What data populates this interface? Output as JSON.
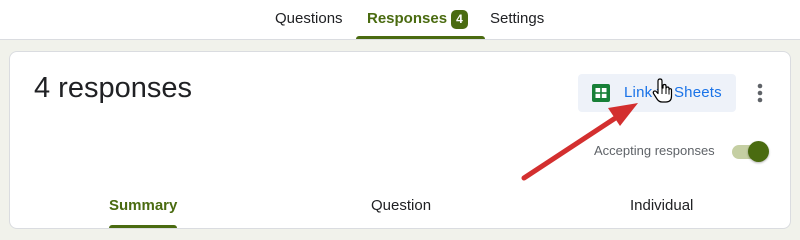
{
  "top_tabs": [
    {
      "label": "Questions"
    },
    {
      "label": "Responses",
      "badge": "4"
    },
    {
      "label": "Settings"
    }
  ],
  "responses_card": {
    "title": "4 responses",
    "link_sheets_label": "Link to Sheets",
    "accepting_label": "Accepting responses",
    "accepting_on": true
  },
  "sub_tabs": [
    {
      "label": "Summary"
    },
    {
      "label": "Question"
    },
    {
      "label": "Individual"
    }
  ],
  "colors": {
    "accent": "#4a6b10",
    "link": "#1a73e8",
    "sheets_green": "#188038",
    "annotation_arrow": "#d32f2f"
  },
  "icons": [
    "sheets-icon",
    "more-vert-icon",
    "hand-pointer-icon",
    "annotation-arrow"
  ]
}
